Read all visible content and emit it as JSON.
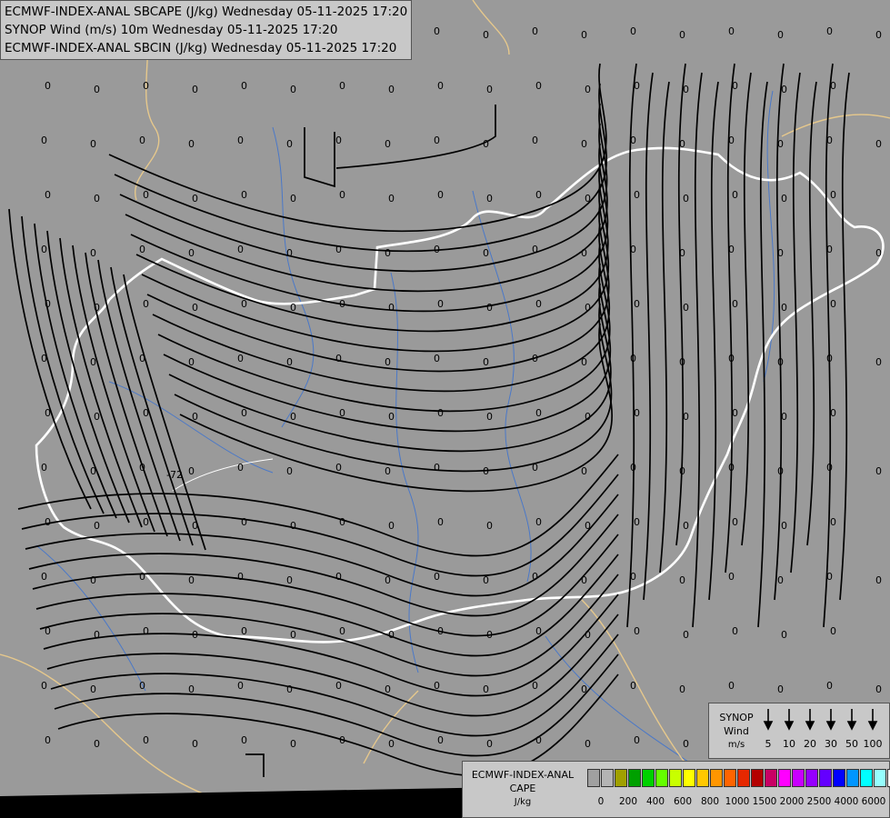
{
  "header": {
    "line1": "ECMWF-INDEX-ANAL SBCAPE (J/kg) Wednesday 05-11-2025 17:20",
    "line2": "SYNOP Wind (m/s) 10m Wednesday 05-11-2025 17:20",
    "line3": "ECMWF-INDEX-ANAL SBCIN (J/kg) Wednesday 05-11-2025 17:20"
  },
  "grid_value": "0",
  "cin_label": "-72",
  "wind_legend": {
    "title_line1": "SYNOP",
    "title_line2": "Wind",
    "title_line3": "m/s",
    "speeds": [
      "5",
      "10",
      "20",
      "30",
      "50",
      "100"
    ]
  },
  "cape_legend": {
    "title_line1": "ECMWF-INDEX-ANAL",
    "title_line2": "CAPE",
    "title_line3": "J/kg",
    "colors": [
      "#a0a0a0",
      "#b4b4b4",
      "#a0a000",
      "#00a000",
      "#00d200",
      "#64ff00",
      "#c8ff00",
      "#ffff00",
      "#ffc800",
      "#ff9600",
      "#ff6400",
      "#e62800",
      "#b40000",
      "#c80064",
      "#ff00ff",
      "#c800ff",
      "#9600ff",
      "#6400ff",
      "#0000ff",
      "#0096ff",
      "#00ffff",
      "#96ffff",
      "#ffffff"
    ],
    "ticks": [
      "0",
      "200",
      "400",
      "600",
      "800",
      "1000",
      "1500",
      "2000",
      "2500",
      "4000",
      "6000"
    ]
  },
  "colors": {
    "background": "#9a9a9a",
    "land": "#9a9a9a",
    "border": "#ffffff",
    "neighbor_border": "#e6c88c",
    "river": "#4a78c8",
    "streamline": "#000000",
    "bottom_band": "#000000"
  }
}
